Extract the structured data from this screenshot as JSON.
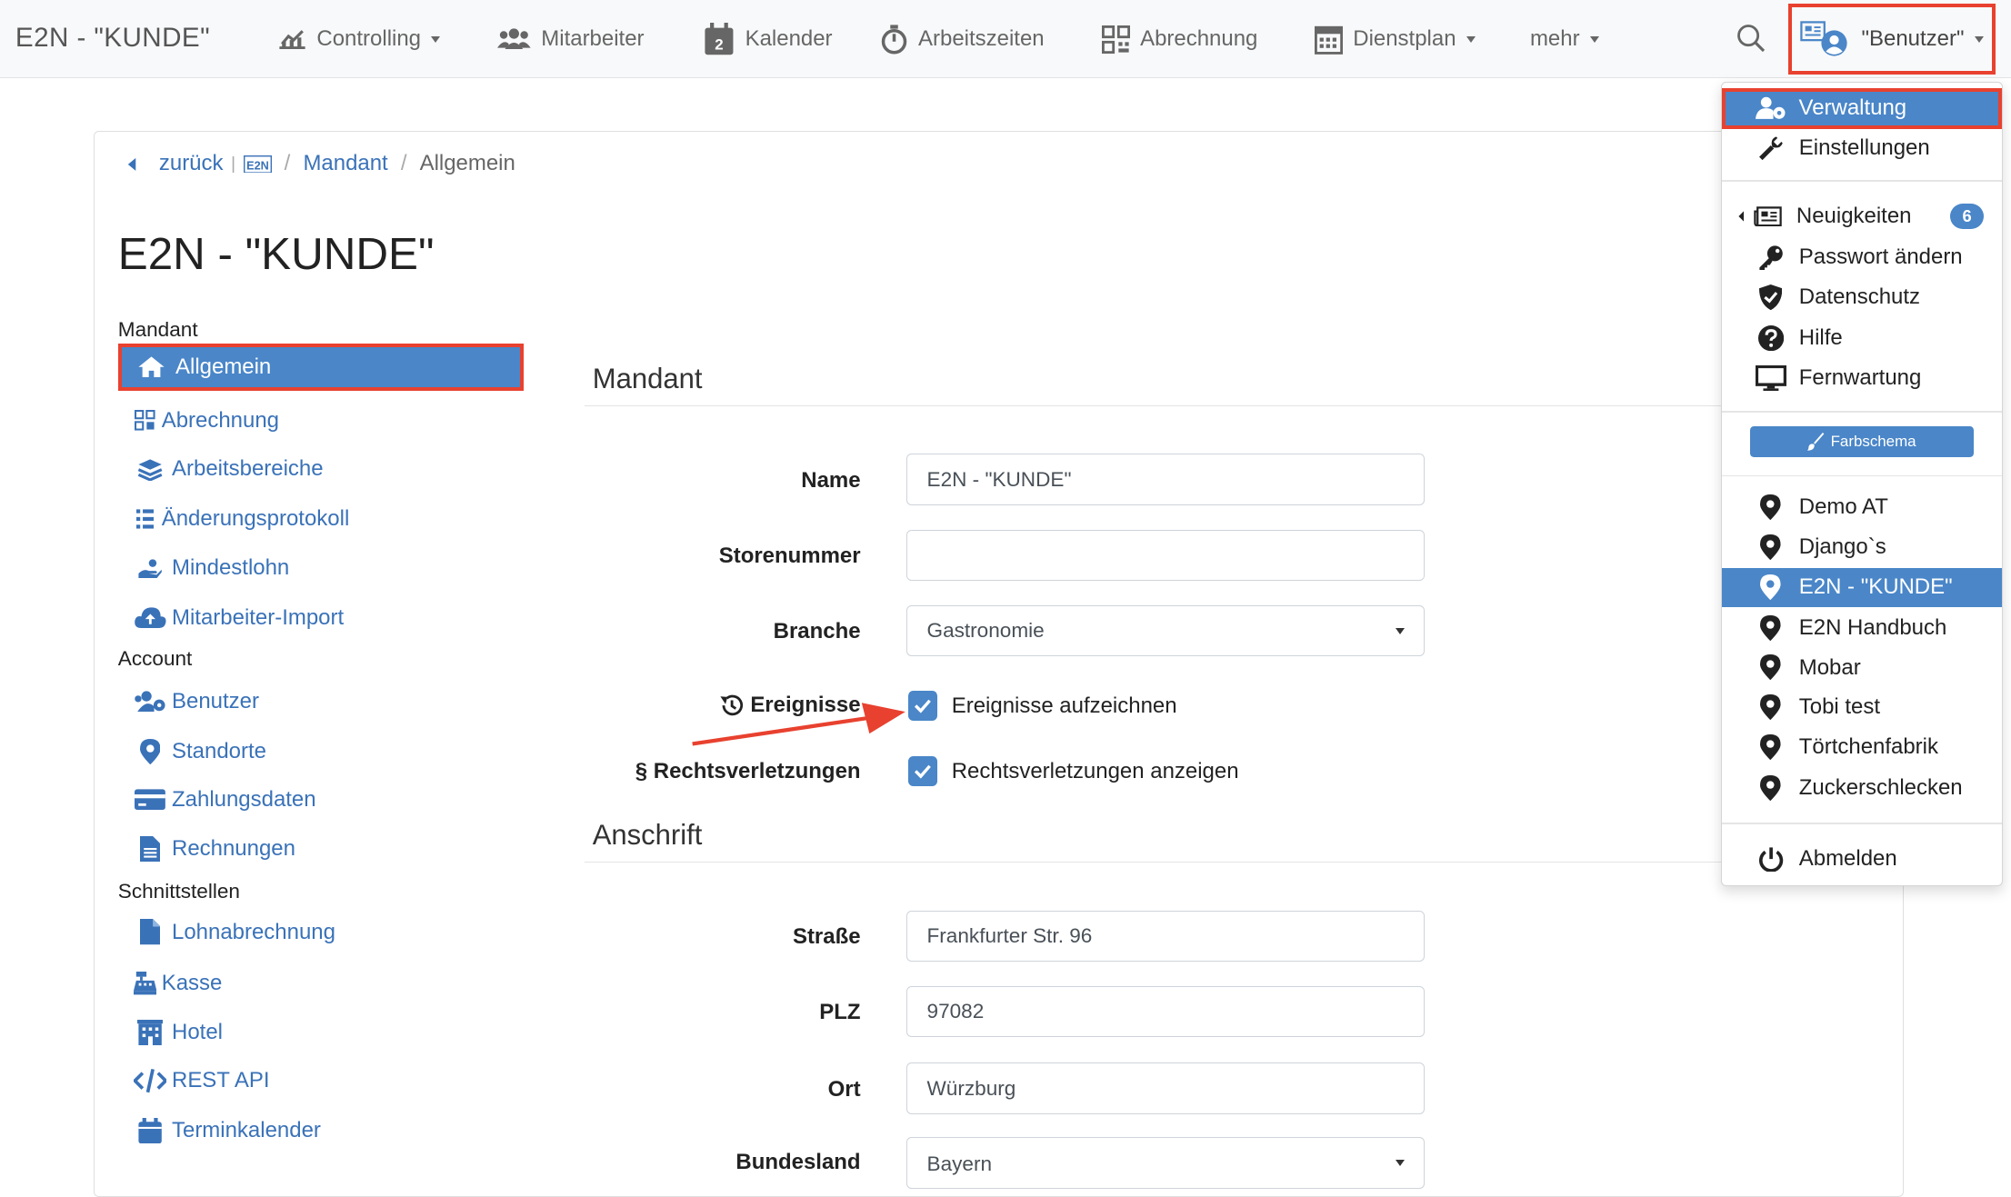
{
  "navbar": {
    "brand": "E2N - \"KUNDE\"",
    "items": [
      {
        "label": "Controlling",
        "icon": "chart-line-icon",
        "dropdown": true
      },
      {
        "label": "Mitarbeiter",
        "icon": "users-icon",
        "dropdown": false
      },
      {
        "label": "Kalender",
        "icon": "calendar-icon",
        "dropdown": false,
        "icon_text": "2"
      },
      {
        "label": "Arbeitszeiten",
        "icon": "stopwatch-icon",
        "dropdown": false
      },
      {
        "label": "Abrechnung",
        "icon": "qr-grid-icon",
        "dropdown": false
      },
      {
        "label": "Dienstplan",
        "icon": "calendar-grid-icon",
        "dropdown": true
      },
      {
        "label": "mehr",
        "dropdown": true
      }
    ],
    "user_label": "\"Benutzer\""
  },
  "breadcrumb": {
    "back": "zurück",
    "logo_text": "E2N",
    "items": [
      "Mandant",
      "Allgemein"
    ]
  },
  "page_title": "E2N - \"KUNDE\"",
  "sidebar": {
    "groups": [
      {
        "heading": "Mandant",
        "items": [
          {
            "label": "Allgemein",
            "icon": "home-icon",
            "active": true
          },
          {
            "label": "Abrechnung",
            "icon": "qr-grid-icon"
          },
          {
            "label": "Arbeitsbereiche",
            "icon": "layers-icon"
          },
          {
            "label": "Änderungsprotokoll",
            "icon": "list-icon"
          },
          {
            "label": "Mindestlohn",
            "icon": "hand-coins-icon"
          },
          {
            "label": "Mitarbeiter-Import",
            "icon": "cloud-upload-icon"
          }
        ]
      },
      {
        "heading": "Account",
        "items": [
          {
            "label": "Benutzer",
            "icon": "users-icon"
          },
          {
            "label": "Standorte",
            "icon": "map-marker-icon"
          },
          {
            "label": "Zahlungsdaten",
            "icon": "credit-card-icon"
          },
          {
            "label": "Rechnungen",
            "icon": "file-icon"
          }
        ]
      },
      {
        "heading": "Schnittstellen",
        "items": [
          {
            "label": "Lohnabrechnung",
            "icon": "file-solid-icon"
          },
          {
            "label": "Kasse",
            "icon": "cash-register-icon"
          },
          {
            "label": "Hotel",
            "icon": "building-icon"
          },
          {
            "label": "REST API",
            "icon": "code-icon"
          },
          {
            "label": "Terminkalender",
            "icon": "calendar-icon"
          }
        ]
      }
    ]
  },
  "form": {
    "section1": "Mandant",
    "name_label": "Name",
    "name_value": "E2N - \"KUNDE\"",
    "store_label": "Storenummer",
    "store_value": "",
    "branche_label": "Branche",
    "branche_value": "Gastronomie",
    "ereignisse_label": "Ereignisse",
    "ereignisse_cb": "Ereignisse aufzeichnen",
    "recht_label": "§ Rechtsverletzungen",
    "recht_cb": "Rechtsverletzungen anzeigen",
    "section2": "Anschrift",
    "strasse_label": "Straße",
    "strasse_value": "Frankfurter Str. 96",
    "plz_label": "PLZ",
    "plz_value": "97082",
    "ort_label": "Ort",
    "ort_value": "Würzburg",
    "bundesland_label": "Bundesland",
    "bundesland_value": "Bayern"
  },
  "user_menu": {
    "verwaltung": "Verwaltung",
    "einstellungen": "Einstellungen",
    "neuigkeiten": "Neuigkeiten",
    "neuigkeiten_badge": "6",
    "passwort": "Passwort ändern",
    "datenschutz": "Datenschutz",
    "hilfe": "Hilfe",
    "fernwartung": "Fernwartung",
    "farbschema": "Farbschema",
    "locations": [
      "Demo AT",
      "Django`s",
      "E2N - \"KUNDE\"",
      "E2N Handbuch",
      "Mobar",
      "Tobi test",
      "Törtchenfabrik",
      "Zuckerschlecken"
    ],
    "active_location": "E2N - \"KUNDE\"",
    "abmelden": "Abmelden"
  },
  "colors": {
    "primary": "#4a86c8",
    "link": "#3a72b8",
    "highlight": "#e8412f"
  }
}
